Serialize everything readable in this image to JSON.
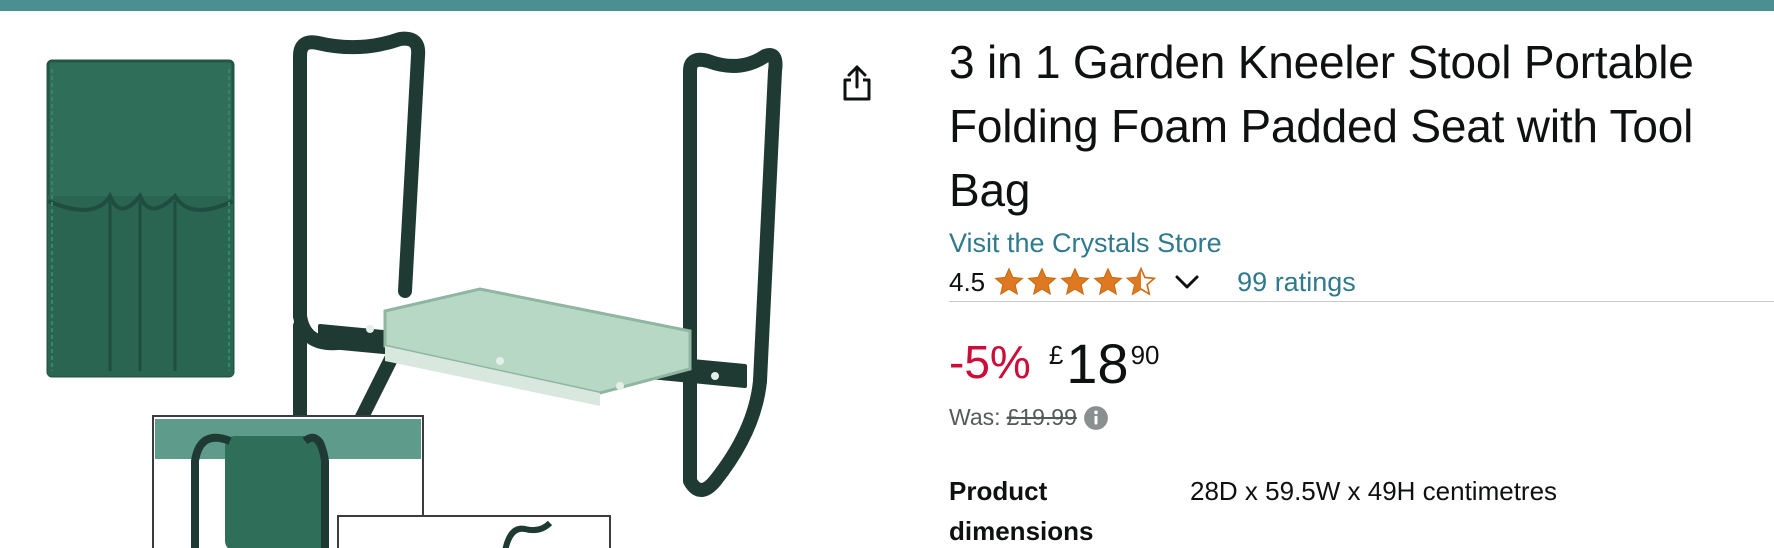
{
  "product": {
    "title": "3 in 1 Garden Kneeler Stool Portable Folding Foam Padded Seat with Tool Bag",
    "store_link": "Visit the Crystals Store",
    "rating_value": "4.5",
    "rating_stars": 4.5,
    "ratings_count": "99 ratings"
  },
  "pricing": {
    "discount": "-5%",
    "currency_symbol": "£",
    "price_whole": "18",
    "price_fraction": "90",
    "was_label": "Was:",
    "was_price": "£19.99"
  },
  "specs": [
    {
      "label": "Product dimensions",
      "value": "28D x 59.5W x 49H centimetres"
    }
  ],
  "colors": {
    "top_bar": "#4b8f91",
    "link": "#2f7a8c",
    "discount": "#cc0c39",
    "star": "#de7921",
    "frame": "#1f3a33",
    "bag": "#2f6f5a",
    "cushion": "#b8d8c6"
  },
  "icons": {
    "share": "share-icon",
    "star": "star-icon",
    "chevron": "chevron-down-icon",
    "info": "info-icon"
  }
}
